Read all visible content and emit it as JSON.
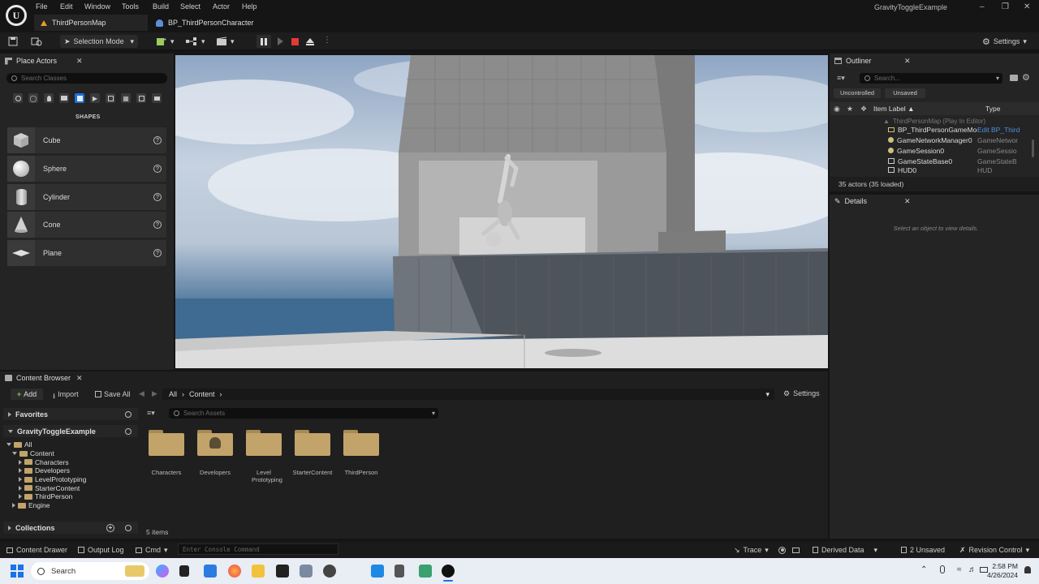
{
  "menu": [
    "File",
    "Edit",
    "Window",
    "Tools",
    "Build",
    "Select",
    "Actor",
    "Help"
  ],
  "window_title": "GravityToggleExample",
  "tabs": {
    "map": "ThirdPersonMap",
    "blueprint": "BP_ThirdPersonCharacter"
  },
  "toolbar": {
    "mode": "Selection Mode",
    "settings": "Settings"
  },
  "place_actors": {
    "title": "Place Actors",
    "search_placeholder": "Search Classes",
    "section": "SHAPES",
    "items": [
      "Cube",
      "Sphere",
      "Cylinder",
      "Cone",
      "Plane"
    ]
  },
  "outliner": {
    "title": "Outliner",
    "search_placeholder": "Search...",
    "filter_uncontrolled": "Uncontrolled",
    "filter_unsaved": "Unsaved",
    "col_label": "Item Label",
    "col_type": "Type",
    "root": "ThirdPersonMap (Play In Editor)",
    "rows": [
      {
        "label": "BP_ThirdPersonGameMode",
        "type": "Edit BP_Third"
      },
      {
        "label": "GameNetworkManager0",
        "type": "GameNetwor"
      },
      {
        "label": "GameSession0",
        "type": "GameSessio"
      },
      {
        "label": "GameStateBase0",
        "type": "GameStateB"
      },
      {
        "label": "HUD0",
        "type": "HUD"
      }
    ],
    "count": "35 actors (35 loaded)"
  },
  "details": {
    "title": "Details",
    "empty": "Select an object to view details."
  },
  "content_browser": {
    "title": "Content Browser",
    "add": "Add",
    "import": "Import",
    "save_all": "Save All",
    "path": [
      "All",
      "Content"
    ],
    "settings": "Settings",
    "favorites": "Favorites",
    "project": "GravityToggleExample",
    "tree": {
      "all": "All",
      "content": "Content",
      "children": [
        "Characters",
        "Developers",
        "LevelPrototyping",
        "StarterContent",
        "ThirdPerson"
      ],
      "engine": "Engine"
    },
    "collections": "Collections",
    "search_placeholder": "Search Assets",
    "assets": [
      "Characters",
      "Developers",
      "Level Prototyping",
      "StarterContent",
      "ThirdPerson"
    ],
    "item_count": "5 items"
  },
  "status_bar": {
    "drawer": "Content Drawer",
    "output": "Output Log",
    "cmd": "Cmd",
    "console_placeholder": "Enter Console Command",
    "trace": "Trace",
    "derived": "Derived Data",
    "unsaved": "2 Unsaved",
    "revision": "Revision Control"
  },
  "taskbar": {
    "search": "Search",
    "time": "2:58 PM",
    "date": "4/26/2024"
  },
  "colors": {
    "accent_blue": "#1f6fd6",
    "stop_red": "#e53935",
    "folder": "#c2a36a"
  }
}
